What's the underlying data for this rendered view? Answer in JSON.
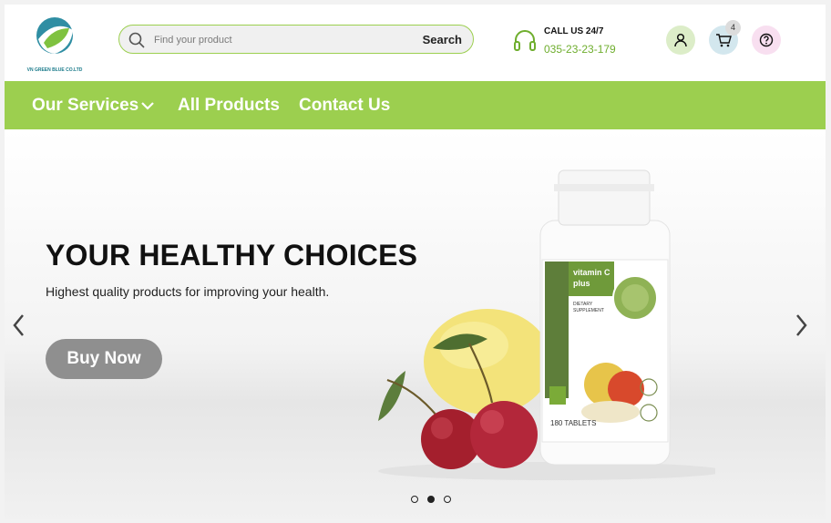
{
  "brand": {
    "logo_text": "VN GREEN BLUE CO.LTD"
  },
  "search": {
    "placeholder": "Find your product",
    "button_label": "Search"
  },
  "contact": {
    "title": "CALL US 24/7",
    "phone": "035-23-23-179"
  },
  "cart": {
    "count": "4"
  },
  "nav": {
    "services": "Our Services",
    "products": "All Products",
    "contact": "Contact Us"
  },
  "hero": {
    "title": "YOUR HEALTHY CHOICES",
    "subtitle": "Highest quality products for improving your  health.",
    "cta": "Buy Now",
    "product_label_line1": "vitamin C",
    "product_label_line2": "plus",
    "product_label_small1": "DIETARY",
    "product_label_small2": "SUPPLEMENT",
    "product_count": "180 TABLETS"
  },
  "carousel": {
    "slides": 3,
    "active_index": 1
  },
  "colors": {
    "accent_green": "#9ccf4f",
    "phone_green": "#6fae2e",
    "button_gray": "#8f8f8f"
  }
}
